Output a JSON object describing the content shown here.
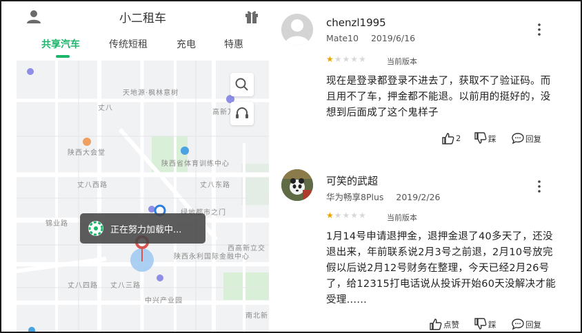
{
  "app": {
    "title": "小二租车",
    "tabs": [
      {
        "label": "共享汽车",
        "active": true
      },
      {
        "label": "传统短租",
        "active": false
      },
      {
        "label": "充电",
        "active": false
      },
      {
        "label": "特惠",
        "active": false
      }
    ],
    "accent_color": "#1bb66b",
    "map_labels": [
      "天地源·枫林意树",
      "丈八",
      "高新万",
      "陕西大会堂",
      "陕西省体育训练中心",
      "丈八东路",
      "丈八西路",
      "绿地都市之门",
      "锦业路",
      "西高新立交",
      "陕西永利国际金融中心",
      "丈八四路",
      "丈八三路",
      "中兴产业园",
      "南北新"
    ],
    "loading_text": "正在努力加载中..."
  },
  "reviews": [
    {
      "name": "chenzl1995",
      "device": "Mate10",
      "date": "2019/6/16",
      "rating": 1,
      "version_label": "当前版本",
      "text": "现在是登录都登录不进去了，获取不了验证码。而且用不了车，押金都不能退。以前用的挺好的，没想到后面成了这个鬼样子",
      "like_label": "2",
      "dislike_label": "踩",
      "reply_label": "回复"
    },
    {
      "name": "可笑的武超",
      "device": "华为畅享8Plus",
      "date": "2019/2/26",
      "rating": 1,
      "version_label": "当前版本",
      "text": "1月14号申请退押金，退押金退了40多天了，还没退出来，年前联系说2月3号之前退，2月10号放完假以后说2月12号财务在整理，今天已经2月26号了，给12315打电话说从投诉开始60天没解决才能受理......",
      "like_label": "点赞",
      "dislike_label": "踩",
      "reply_label": "回复"
    }
  ]
}
